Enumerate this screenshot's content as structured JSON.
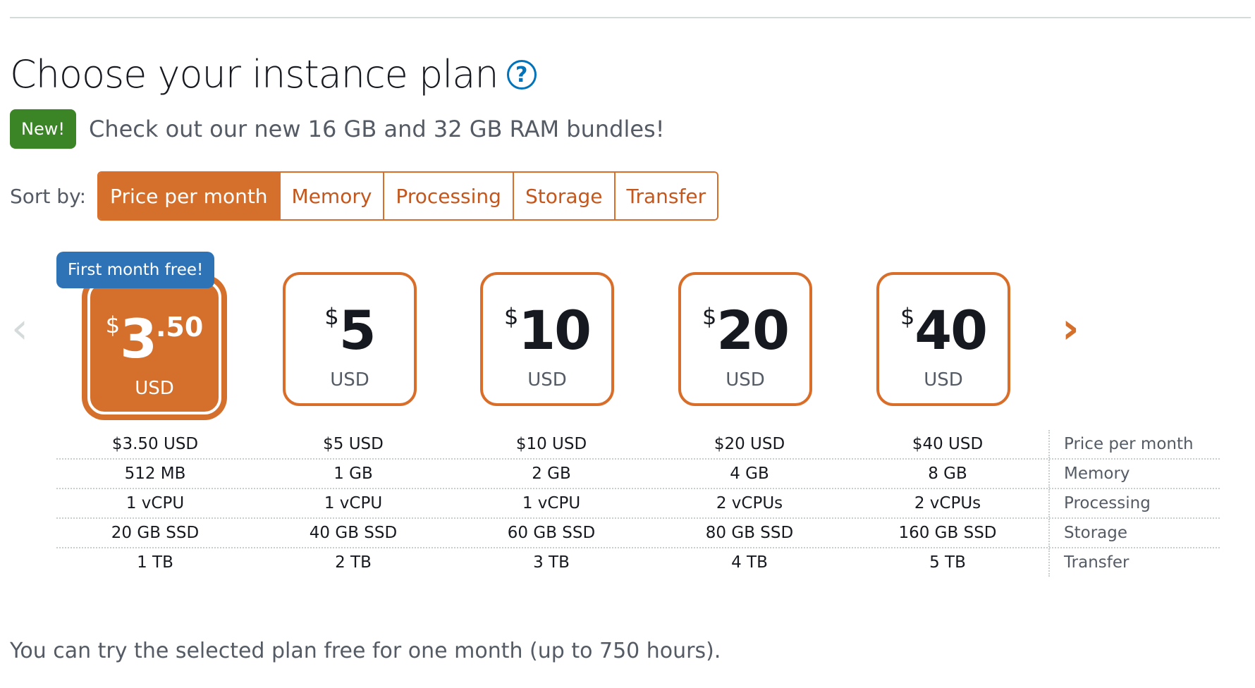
{
  "page": {
    "title": "Choose your instance plan",
    "help_icon": "?"
  },
  "announcement": {
    "badge": "New!",
    "text": "Check out our new 16 GB and 32 GB RAM bundles!"
  },
  "sort": {
    "label": "Sort by:",
    "options": [
      "Price per month",
      "Memory",
      "Processing",
      "Storage",
      "Transfer"
    ],
    "active": "Price per month"
  },
  "carousel": {
    "prev_icon": "‹",
    "next_icon": "›"
  },
  "plans": [
    {
      "dollar": "$",
      "amount": "3",
      "cents": ".50",
      "currency": "USD",
      "selected": true,
      "badge": "First month free!"
    },
    {
      "dollar": "$",
      "amount": "5",
      "cents": "",
      "currency": "USD"
    },
    {
      "dollar": "$",
      "amount": "10",
      "cents": "",
      "currency": "USD"
    },
    {
      "dollar": "$",
      "amount": "20",
      "cents": "",
      "currency": "USD"
    },
    {
      "dollar": "$",
      "amount": "40",
      "cents": "",
      "currency": "USD"
    }
  ],
  "specs": {
    "labels": [
      "Price per month",
      "Memory",
      "Processing",
      "Storage",
      "Transfer"
    ],
    "rows": [
      [
        "$3.50 USD",
        "$5 USD",
        "$10 USD",
        "$20 USD",
        "$40 USD"
      ],
      [
        "512 MB",
        "1 GB",
        "2 GB",
        "4 GB",
        "8 GB"
      ],
      [
        "1 vCPU",
        "1 vCPU",
        "1 vCPU",
        "2 vCPUs",
        "2 vCPUs"
      ],
      [
        "20 GB SSD",
        "40 GB SSD",
        "60 GB SSD",
        "80 GB SSD",
        "160 GB SSD"
      ],
      [
        "1 TB",
        "2 TB",
        "3 TB",
        "4 TB",
        "5 TB"
      ]
    ]
  },
  "footer": {
    "note": "You can try the selected plan free for one month (up to 750 hours)."
  },
  "colors": {
    "accent": "#d4702c",
    "new_badge": "#3c8527",
    "free_badge": "#2d73b6",
    "help": "#0073bb"
  }
}
